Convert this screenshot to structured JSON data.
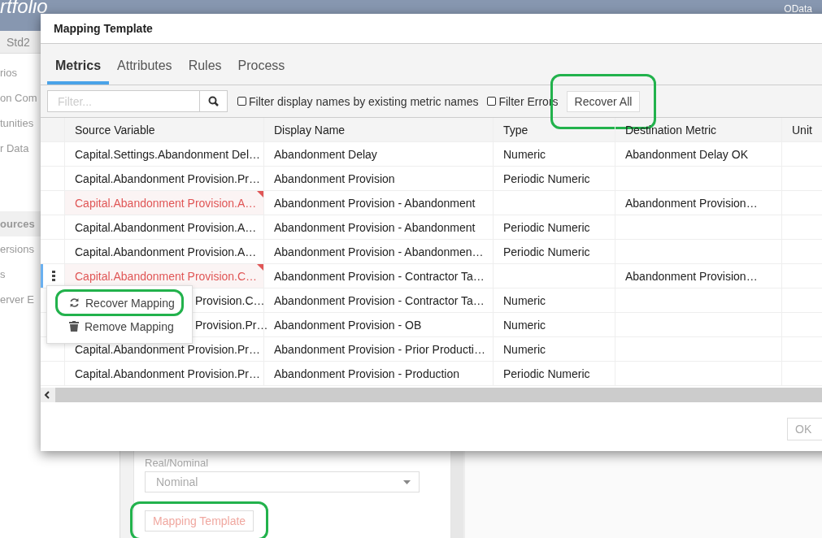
{
  "app": {
    "logo": "rtfolio",
    "header_link": "OData",
    "tab": "Std2",
    "sidebar": [
      {
        "label": "rios",
        "selected": false
      },
      {
        "label": "on Com",
        "selected": false
      },
      {
        "label": "tunities",
        "selected": false
      },
      {
        "label": "r Data",
        "selected": false
      },
      {
        "label": "ources",
        "selected": true
      },
      {
        "label": "ersions",
        "selected": false
      },
      {
        "label": "s",
        "selected": false
      },
      {
        "label": "erver E",
        "selected": false
      }
    ],
    "form": {
      "field_label": "Real/Nominal",
      "select_value": "Nominal",
      "button": {
        "label": "Mapping Template",
        "highlighted": true
      }
    }
  },
  "dialog": {
    "title": "Mapping Template",
    "tabs": [
      {
        "label": "Metrics",
        "selected": true
      },
      {
        "label": "Attributes",
        "selected": false
      },
      {
        "label": "Rules",
        "selected": false
      },
      {
        "label": "Process",
        "selected": false
      }
    ],
    "filter": {
      "placeholder": "Filter..."
    },
    "checkboxes": [
      {
        "label": "Filter display names by existing metric names",
        "checked": false
      },
      {
        "label": "Filter Errors",
        "checked": false
      }
    ],
    "recover_all": {
      "label": "Recover All",
      "highlighted": true
    },
    "columns": [
      "Source Variable",
      "Display Name",
      "Type",
      "Destination Metric",
      "Unit"
    ],
    "rows": [
      {
        "source": "Capital.Settings.Abandonment Del…",
        "display": "Abandonment Delay",
        "type": "Numeric",
        "destination": "Abandonment Delay OK",
        "error": false,
        "active": false,
        "covered": false
      },
      {
        "source": "Capital.Abandonment Provision.Pr…",
        "display": "Abandonment Provision",
        "type": "Periodic Numeric",
        "destination": "",
        "error": false,
        "active": false,
        "covered": false
      },
      {
        "source": "Capital.Abandonment Provision.A…",
        "display": "Abandonment Provision - Abandonment",
        "type": "",
        "destination": "Abandonment Provision…",
        "error": true,
        "active": false,
        "covered": false
      },
      {
        "source": "Capital.Abandonment Provision.A…",
        "display": "Abandonment Provision - Abandonment",
        "type": "Periodic Numeric",
        "destination": "",
        "error": false,
        "active": false,
        "covered": false
      },
      {
        "source": "Capital.Abandonment Provision.A…",
        "display": "Abandonment Provision - Abandonmen…",
        "type": "Periodic Numeric",
        "destination": "",
        "error": false,
        "active": false,
        "covered": false
      },
      {
        "source": "Capital.Abandonment Provision.C…",
        "display": "Abandonment Provision - Contractor Ta…",
        "type": "",
        "destination": "Abandonment Provision…",
        "error": true,
        "active": true,
        "covered": false
      },
      {
        "source": "Provision.C…",
        "display": "Abandonment Provision - Contractor Ta…",
        "type": "Numeric",
        "destination": "",
        "error": false,
        "active": false,
        "covered": true
      },
      {
        "source": "Provision.Pr…",
        "display": "Abandonment Provision - OB",
        "type": "Numeric",
        "destination": "",
        "error": false,
        "active": false,
        "covered": true
      },
      {
        "source": "Capital.Abandonment Provision.Pr…",
        "display": "Abandonment Provision - Prior Producti…",
        "type": "Numeric",
        "destination": "",
        "error": false,
        "active": false,
        "covered": false
      },
      {
        "source": "Capital.Abandonment Provision.Pr…",
        "display": "Abandonment Provision - Production",
        "type": "Periodic Numeric",
        "destination": "",
        "error": false,
        "active": false,
        "covered": false
      }
    ],
    "menu": [
      {
        "kind": "recover",
        "label": "Recover Mapping",
        "highlighted": true
      },
      {
        "kind": "remove",
        "label": "Remove Mapping",
        "highlighted": false
      }
    ],
    "ok": "OK"
  }
}
